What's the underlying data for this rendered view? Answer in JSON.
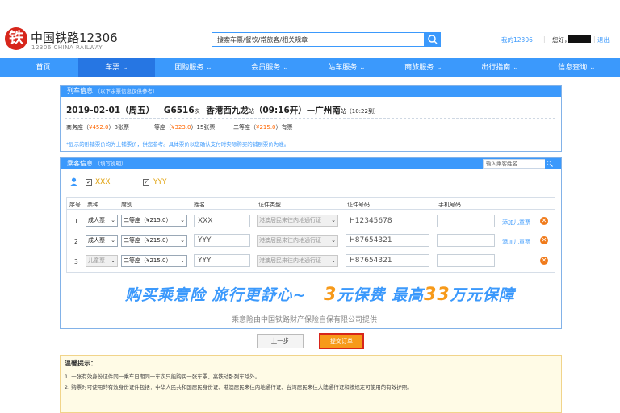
{
  "header": {
    "logo_mark": "铁",
    "logo_cn": "中国铁路12306",
    "logo_en": "12306 CHINA RAILWAY",
    "search_placeholder": "搜索车票/餐饮/常旅客/相关规章",
    "my_account": "我的12306",
    "greeting": "您好，",
    "logout": "退出"
  },
  "nav": {
    "items": [
      {
        "label": "首页"
      },
      {
        "label": "车票 ⌄"
      },
      {
        "label": "团购服务 ⌄"
      },
      {
        "label": "会员服务 ⌄"
      },
      {
        "label": "站车服务 ⌄"
      },
      {
        "label": "商旅服务 ⌄"
      },
      {
        "label": "出行指南 ⌄"
      },
      {
        "label": "信息查询 ⌄"
      }
    ]
  },
  "train_info": {
    "title": "列车信息",
    "subtitle": "（以下余票信息仅供参考）",
    "date": "2019-02-01（周五）",
    "train_no": "G6516",
    "train_suffix": "次",
    "from_station": "香港西九龙",
    "from_suffix": "站",
    "depart_time": "（09:16开）",
    "arrow": "—",
    "to_station": "广州南",
    "to_suffix": "站",
    "arrive_time": "（10:22到）",
    "seats": [
      {
        "name": "商务座（",
        "price": "¥452.0",
        "rest": "）8张票"
      },
      {
        "name": "一等座（",
        "price": "¥323.0",
        "rest": "）15张票"
      },
      {
        "name": "二等座（",
        "price": "¥215.0",
        "rest": "）有票"
      }
    ],
    "note": "*显示的卧铺票价均为上铺票价，供您参考。具体票价以您确认支付时实际购买的铺别票价为准。"
  },
  "passenger_info": {
    "title": "乘客信息",
    "subtitle": "（填写说明）",
    "search_placeholder": "输入乘客姓名",
    "contacts": [
      {
        "name": "XXX",
        "checked": "✓"
      },
      {
        "name": "YYY",
        "checked": "✓"
      }
    ],
    "columns": [
      "序号",
      "票种",
      "席别",
      "姓名",
      "证件类型",
      "证件号码",
      "手机号码"
    ],
    "rows": [
      {
        "no": "1",
        "ticket_type": "成人票",
        "seat": "二等座（¥215.0）",
        "name": "XXX",
        "id_type": "港澳居民来往内地通行证",
        "id_no": "H12345678",
        "phone": "",
        "add_child": "添加儿童票"
      },
      {
        "no": "2",
        "ticket_type": "成人票",
        "seat": "二等座（¥215.0）",
        "name": "YYY",
        "id_type": "港澳居民来往内地通行证",
        "id_no": "H87654321",
        "phone": "",
        "add_child": "添加儿童票"
      },
      {
        "no": "3",
        "ticket_type": "儿童票",
        "seat": "二等座（¥215.0）",
        "name": "YYY",
        "id_type": "港澳居民来往内地通行证",
        "id_no": "H87654321",
        "phone": ""
      }
    ],
    "caret": "⌄",
    "delete_mark": "✕"
  },
  "banner": {
    "part1": "购买乘意险  旅行更舒心~",
    "num1": "3",
    "part2": "元保费  最高",
    "num2": "33",
    "part3": "万元保障",
    "sub": "乘意险由中国铁路财产保险自保有限公司提供"
  },
  "actions": {
    "prev": "上一步",
    "submit": "提交订单"
  },
  "tips": {
    "title": "温馨提示：",
    "lines": [
      "1. 一张有效身份证件同一乘车日期同一车次只能购买一张车票，高铁动卧列车除外。",
      "2. 购票时可使用的有效身份证件包括：中华人民共和国居民身份证、港澳居民来往内地通行证、台湾居民来往大陆通行证和按规定可使用的有效护照。"
    ]
  },
  "colors": {
    "accent": "#3b99fc",
    "nav_active": "#2676e3",
    "brand_red": "#d7261b",
    "price_orange": "#ff6600",
    "submit_orange": "#f79a1a"
  }
}
